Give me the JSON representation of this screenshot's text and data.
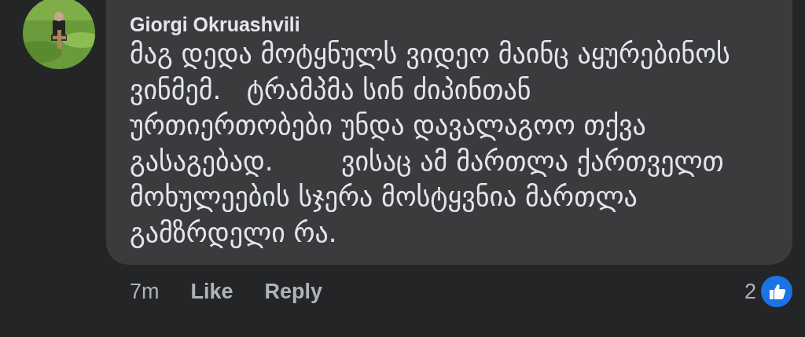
{
  "comment": {
    "author": "Giorgi Okruashvili",
    "lines": [
      "მაგ დედა მოტყნულს ვიდეო მაინც აყურებინოს",
      "ვინმემ.   ტრამპმა სინ ძიპინთან",
      "ურთიერთობები უნდა დავალაგოო თქვა",
      "გასაგებად.        ვისაც ამ მართლა ქართველთ",
      "მოხულეების სჯერა მოსტყვნია მართლა",
      "გამზრდელი რა."
    ],
    "time": "7m",
    "actions": [
      "Like",
      "Reply"
    ],
    "reaction_count": "2"
  }
}
